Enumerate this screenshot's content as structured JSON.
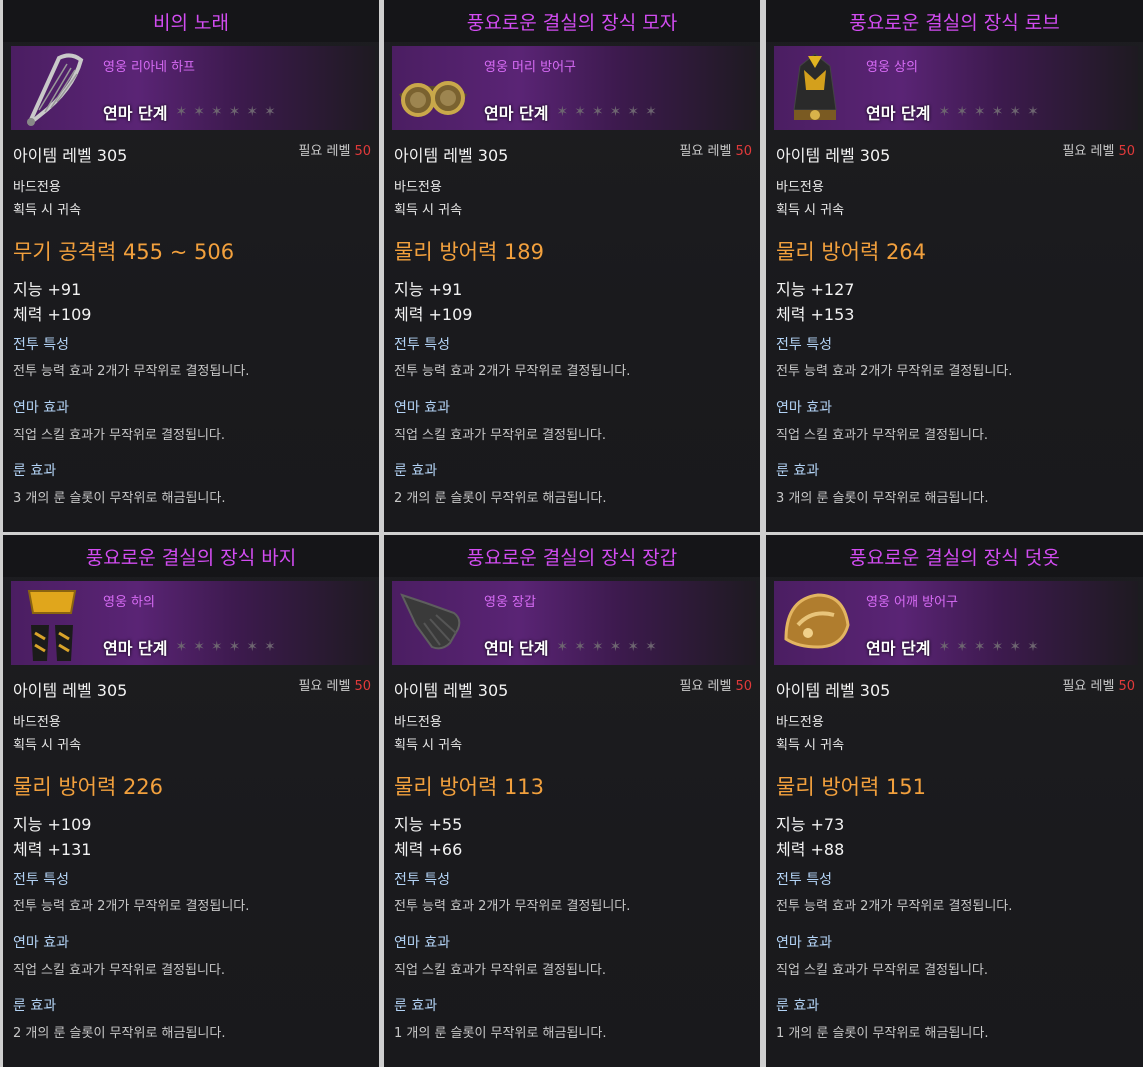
{
  "colors": {
    "title": "#d24cf1",
    "type_text": "#d76bf5",
    "main_stat": "#f2a03d",
    "required_level": "#e13a3a",
    "section_header": "#b3d3f5"
  },
  "cards": [
    {
      "name": "비의 노래",
      "type": "영웅 리아네 하프",
      "icon": "harp-icon",
      "stage": "연마 단계",
      "item_level": "아이템 레벨 305",
      "req_label": "필요 레벨",
      "req_value": "50",
      "class": "바드전용",
      "bind": "획득 시 귀속",
      "main_stat": "무기 공격력 455 ~ 506",
      "stat1": "지능 +91",
      "stat2": "체력 +109",
      "battle_header": "전투 특성",
      "battle_desc": "전투 능력 효과 2개가 무작위로 결정됩니다.",
      "refine_header": "연마 효과",
      "refine_desc": "직업 스킬 효과가 무작위로 결정됩니다.",
      "rune_header": "룬 효과",
      "rune_desc": "3 개의 룬 슬롯이 무작위로 해금됩니다."
    },
    {
      "name": "풍요로운 결실의 장식 모자",
      "type": "영웅 머리 방어구",
      "icon": "goggles-icon",
      "stage": "연마 단계",
      "item_level": "아이템 레벨 305",
      "req_label": "필요 레벨",
      "req_value": "50",
      "class": "바드전용",
      "bind": "획득 시 귀속",
      "main_stat": "물리 방어력 189",
      "stat1": "지능 +91",
      "stat2": "체력 +109",
      "battle_header": "전투 특성",
      "battle_desc": "전투 능력 효과 2개가 무작위로 결정됩니다.",
      "refine_header": "연마 효과",
      "refine_desc": "직업 스킬 효과가 무작위로 결정됩니다.",
      "rune_header": "룬 효과",
      "rune_desc": "2 개의 룬 슬롯이 무작위로 해금됩니다."
    },
    {
      "name": "풍요로운 결실의 장식 로브",
      "type": "영웅 상의",
      "icon": "robe-icon",
      "stage": "연마 단계",
      "item_level": "아이템 레벨 305",
      "req_label": "필요 레벨",
      "req_value": "50",
      "class": "바드전용",
      "bind": "획득 시 귀속",
      "main_stat": "물리 방어력 264",
      "stat1": "지능 +127",
      "stat2": "체력 +153",
      "battle_header": "전투 특성",
      "battle_desc": "전투 능력 효과 2개가 무작위로 결정됩니다.",
      "refine_header": "연마 효과",
      "refine_desc": "직업 스킬 효과가 무작위로 결정됩니다.",
      "rune_header": "룬 효과",
      "rune_desc": "3 개의 룬 슬롯이 무작위로 해금됩니다."
    },
    {
      "name": "풍요로운 결실의 장식 바지",
      "type": "영웅 하의",
      "icon": "pants-icon",
      "stage": "연마 단계",
      "item_level": "아이템 레벨 305",
      "req_label": "필요 레벨",
      "req_value": "50",
      "class": "바드전용",
      "bind": "획득 시 귀속",
      "main_stat": "물리 방어력 226",
      "stat1": "지능 +109",
      "stat2": "체력 +131",
      "battle_header": "전투 특성",
      "battle_desc": "전투 능력 효과 2개가 무작위로 결정됩니다.",
      "refine_header": "연마 효과",
      "refine_desc": "직업 스킬 효과가 무작위로 결정됩니다.",
      "rune_header": "룬 효과",
      "rune_desc": "2 개의 룬 슬롯이 무작위로 해금됩니다."
    },
    {
      "name": "풍요로운 결실의 장식 장갑",
      "type": "영웅 장갑",
      "icon": "glove-icon",
      "stage": "연마 단계",
      "item_level": "아이템 레벨 305",
      "req_label": "필요 레벨",
      "req_value": "50",
      "class": "바드전용",
      "bind": "획득 시 귀속",
      "main_stat": "물리 방어력 113",
      "stat1": "지능 +55",
      "stat2": "체력 +66",
      "battle_header": "전투 특성",
      "battle_desc": "전투 능력 효과 2개가 무작위로 결정됩니다.",
      "refine_header": "연마 효과",
      "refine_desc": "직업 스킬 효과가 무작위로 결정됩니다.",
      "rune_header": "룬 효과",
      "rune_desc": "1 개의 룬 슬롯이 무작위로 해금됩니다."
    },
    {
      "name": "풍요로운 결실의 장식 덧옷",
      "type": "영웅 어깨 방어구",
      "icon": "shoulder-armor-icon",
      "stage": "연마 단계",
      "item_level": "아이템 레벨 305",
      "req_label": "필요 레벨",
      "req_value": "50",
      "class": "바드전용",
      "bind": "획득 시 귀속",
      "main_stat": "물리 방어력 151",
      "stat1": "지능 +73",
      "stat2": "체력 +88",
      "battle_header": "전투 특성",
      "battle_desc": "전투 능력 효과 2개가 무작위로 결정됩니다.",
      "refine_header": "연마 효과",
      "refine_desc": "직업 스킬 효과가 무작위로 결정됩니다.",
      "rune_header": "룬 효과",
      "rune_desc": "1 개의 룬 슬롯이 무작위로 해금됩니다."
    }
  ]
}
